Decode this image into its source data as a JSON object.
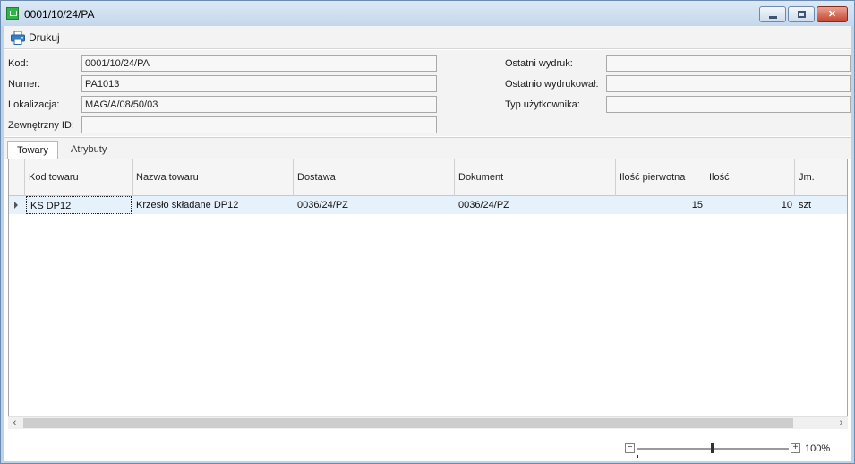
{
  "window": {
    "title": "0001/10/24/PA",
    "app_icon": "basket-icon",
    "controls": {
      "minimize": "minimize-icon",
      "maximize": "restore-icon",
      "close": "close-icon"
    }
  },
  "toolbar": {
    "print_label": "Drukuj",
    "print_icon": "printer-icon"
  },
  "form": {
    "kod_label": "Kod:",
    "kod_value": "0001/10/24/PA",
    "numer_label": "Numer:",
    "numer_value": "PA1013",
    "lokalizacja_label": "Lokalizacja:",
    "lokalizacja_value": "MAG/A/08/50/03",
    "zewnetrzny_label": "Zewnętrzny ID:",
    "zewnetrzny_value": "",
    "ostatni_wydruk_label": "Ostatni wydruk:",
    "ostatni_wydruk_value": "",
    "ostatnio_wydrukowal_label": "Ostatnio wydrukował:",
    "ostatnio_wydrukowal_value": "",
    "typ_uzytkownika_label": "Typ użytkownika:",
    "typ_uzytkownika_value": ""
  },
  "tabs": [
    {
      "label": "Towary",
      "active": true
    },
    {
      "label": "Atrybuty",
      "active": false
    }
  ],
  "grid": {
    "columns": [
      "Kod towaru",
      "Nazwa towaru",
      "Dostawa",
      "Dokument",
      "Ilość pierwotna",
      "Ilość",
      "Jm."
    ],
    "rows": [
      [
        "KS DP12",
        "Krzesło składane DP12",
        "0036/24/PZ",
        "0036/24/PZ",
        "15",
        "10",
        "szt"
      ]
    ]
  },
  "status": {
    "zoom": "100%",
    "zoom_minus": "−",
    "zoom_plus": "+"
  },
  "colors": {
    "accent": "#2fb34a",
    "selected_row": "#e5f1fb",
    "close_button": "#c5452d"
  }
}
